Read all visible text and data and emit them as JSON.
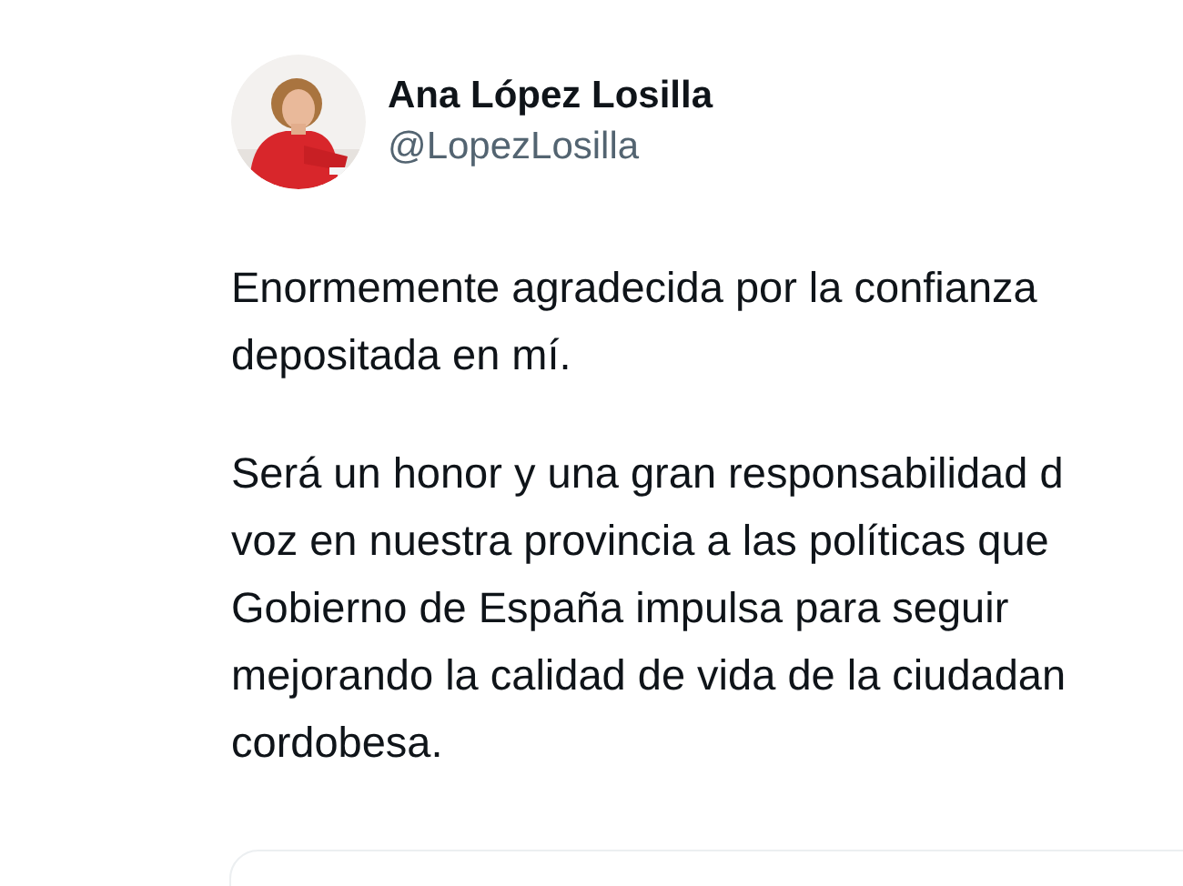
{
  "author": {
    "name": "Ana López Losilla",
    "handle": "@LopezLosilla"
  },
  "paragraphs": [
    "Enormemente agradecida por la confianza\ndepositada en mí.",
    "Será un honor y una gran responsabilidad d\nvoz en nuestra provincia a las políticas que\nGobierno de España impulsa para seguir\nmejorando la calidad de vida de la ciudadan\ncordobesa."
  ]
}
